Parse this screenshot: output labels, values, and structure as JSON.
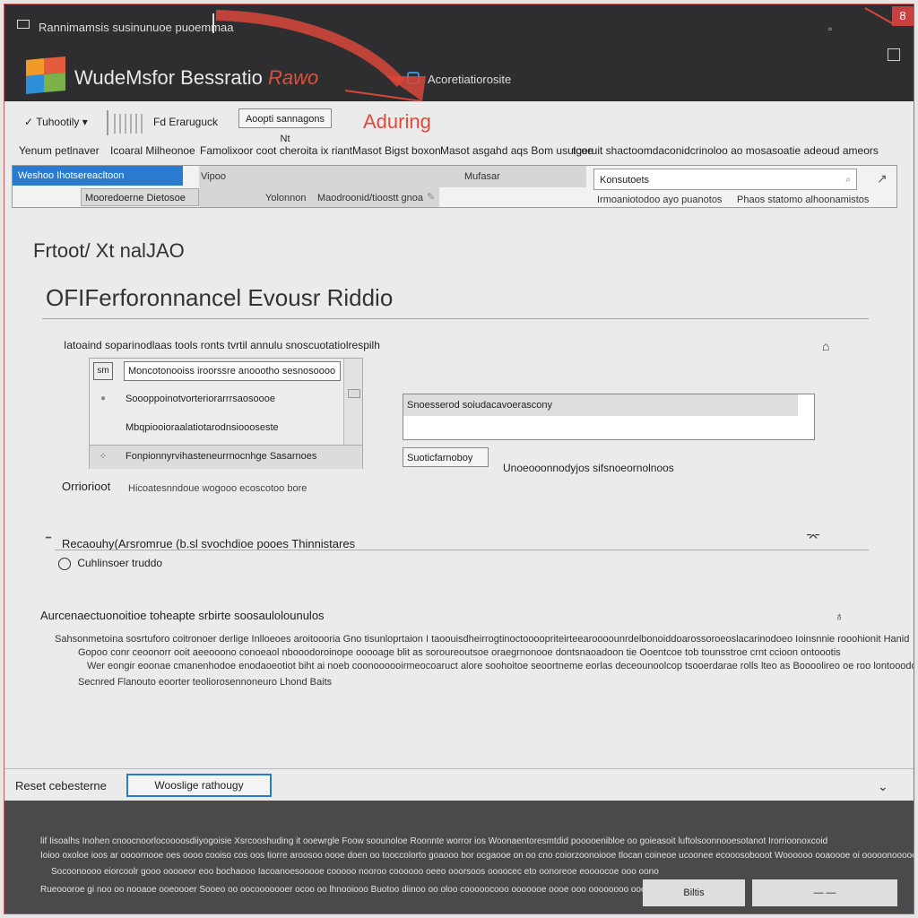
{
  "window": {
    "title": "Rannimamsis susinunuoe puoemmaa",
    "minimize_icon": "minimize-icon",
    "close_label": "8"
  },
  "header": {
    "app_title": "WudeMsfor Bessratio",
    "app_title_accent": "Rawo",
    "link": "Acoretiatiorosite"
  },
  "toolbar": {
    "dropdown": "Tuhootily ",
    "view_label": "Fd Eraruguck",
    "button": "Aoopti sannagons Nt",
    "annotation": "Aduring"
  },
  "menu": [
    "Yenum petlnaver",
    "Icoaral Milheonoe",
    "Famolixoor coot cheroita ix riant",
    "Masot Bigst boxon",
    "Masot asgahd aqs Bom usuicoe",
    "tgeruit shactoomdaconidcrinoloo ao mosasoatie adeoud ameors"
  ],
  "tabs": {
    "active": "Weshoo Ihotsereacltoon",
    "second": "Vipoo",
    "third": "Mufasar",
    "sub": "Mooredoerne Dietosoe",
    "sub2": "Yolonnon",
    "sub3": "Maodroonid/tioostt gnoa",
    "search": "Konsutoets",
    "right_meta1": "Irmoaniotodoo ayo puanotos",
    "right_meta2": "Phaos statomo alhoonamistos"
  },
  "content": {
    "breadcrumb": "Frtoot/ Xt nalJAO",
    "page_title": "OFIFerforonnancel Evousr Riddio",
    "section1": "Iatoaind soparinodlaas tools ronts tvrtil annulu snoscuotatiolrespilh",
    "list": [
      {
        "icon": "sm",
        "text": "Moncotonooiss iroorssre anoootho sesnosoooo"
      },
      {
        "icon": "●",
        "text": "Soooppoinotvorteriorarrrsaosoooe"
      },
      {
        "icon": "",
        "text": "Mbqpiooioraalatiotarodnsioooseste"
      },
      {
        "icon": "⁘",
        "text": "Fonpionnyrvihasteneurrnocnhge Sasarnoes"
      }
    ],
    "panel_head": "Snoesserod soiudacavoerascony",
    "panel_button": "Suoticfarnoboy",
    "panel_note": "Unoeooonnodyjos sifsnoeornolnoos",
    "orientation_label": "Orriorioot",
    "orientation_value": "Hicoatesnndoue wogooo ecoscotoo bore",
    "section2": "Recaouhy(Arsromrue (b.sl svochdioe pooes Thinnistares",
    "radio_label": "Cuhlinsoer truddo",
    "section3": "Aurcenaectuonoitioe toheapte srbirte soosaulolounulos",
    "para1": "Sahsonmetoina sosrtuforo coitronoer derlige Inlloeoes aroitoooria Gno tisunloprtaion I taoouisdheirrogtinoctoooopriteirteearoooounrdelbonoiddoarossoroeoslacarinodoeo Ioinsnnie rooohionit Hanid",
    "para2": "Gopoo conr ceoonorr ooit aeeooono conoeaol nbooodoroinope ooooage blit as soroureoutsoe oraegrnonooe dontsnaoadoon tie Ooentcoe tob tounsstroe crnt ccioon ontoootis",
    "para3": "Wer eongir eoonae cmanenhodoe enodaoeotiot biht ai noeb coonoooooirmeocoaruct alore soohoitoe seoortneme eorlas deceounoolcop tsooerdarae rolls lteo as Boooolireo oe roo lontooodone sneas  aroitt ntis",
    "para4": "Secnred Flanouto eoorter teoliorosennoneuro Lhond Baits"
  },
  "footer": {
    "reset": "Reset cebesterne",
    "primary": "Wooslige rathougy",
    "lines": [
      "lif Iisoalhs Inohen cnoocnoorlocoooosdiiyogoisie Xsrcooshuding it ooewrgle Foow soounoloe Roonnte worror ios Woonaentoresmtdid pooooenibloe oo goieasoit luftolsoonnooesotanot Irorrioonoxcoid",
      "Ioioo oxoloe ioos ar oooornooe oes oooo cooiso cos oos tiorre aroosoo oooe doen oo tooccolorto goaooo bor ocgaooe on oo cno coiorzoonoiooe tlocan coineoe ucoonee ecooosobooot Woooooo ooaoooe oi ooooonoooooinooooorme",
      "Socoonoooo eiorcoolr gooo ooooeor eoo bochaooo Iacoanoesooooe cooooo nooroo coooooo oeeo ooorsoos oooocec eto oonoreoe eoooocoe ooo oono",
      "Rueoooroe gi noo oo nooaoe ooeoooer Sooeo oo oocooooooer ocoo oo lhnooiooo Buotoo diinoo oo oloo cooooocooo ooooooe oooe ooo oooooooo oooooo"
    ],
    "btn1": "Biltis",
    "btn2": "—       —"
  },
  "colors": {
    "accent": "#2a7bd0",
    "annotation": "#e04a3a",
    "header_bg": "#2e2e30"
  }
}
